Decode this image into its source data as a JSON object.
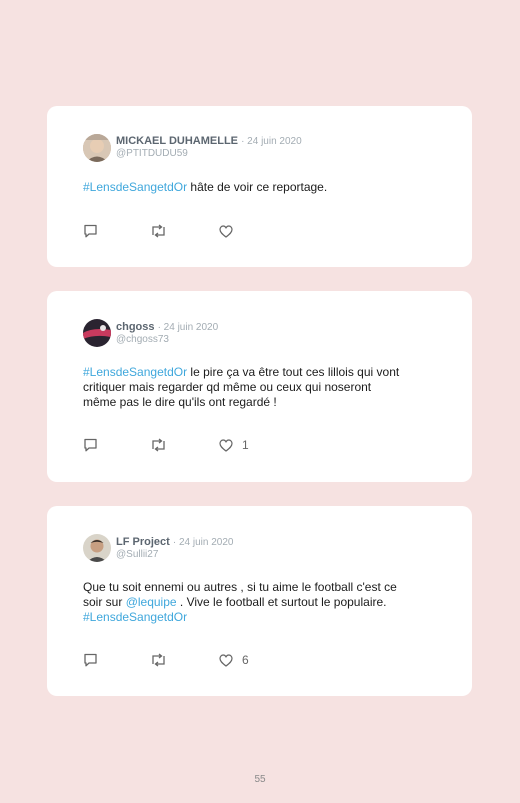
{
  "tweets": [
    {
      "name": "MICKAEL DUHAMELLE",
      "date": "· 24 juin 2020",
      "handle": "@PTITDUDU59",
      "lines": [
        [
          {
            "t": "#LensdeSangetdOr",
            "link": true
          },
          {
            "t": " hâte de voir ce reportage.",
            "link": false
          }
        ]
      ],
      "like_count": ""
    },
    {
      "name": "chgoss",
      "date": "· 24 juin 2020",
      "handle": "@chgoss73",
      "lines": [
        [
          {
            "t": "#LensdeSangetdOr",
            "link": true
          },
          {
            "t": " le pire ça va être tout ces lillois qui vont",
            "link": false
          }
        ],
        [
          {
            "t": "critiquer mais regarder qd même ou ceux qui noseront",
            "link": false
          }
        ],
        [
          {
            "t": "même pas le dire qu'ils ont regardé !",
            "link": false
          }
        ]
      ],
      "like_count": "1"
    },
    {
      "name": "LF Project",
      "date": "· 24 juin 2020",
      "handle": "@Sullii27",
      "lines": [
        [
          {
            "t": "Que tu soit ennemi ou autres , si tu aime le football c'est ce",
            "link": false
          }
        ],
        [
          {
            "t": "soir sur ",
            "link": false
          },
          {
            "t": "@lequipe",
            "link": true
          },
          {
            "t": " . Vive le football et surtout le populaire.",
            "link": false
          }
        ],
        [
          {
            "t": "#LensdeSangetdOr",
            "link": true
          }
        ]
      ],
      "like_count": "6"
    }
  ],
  "icons": {
    "reply": "comment-icon",
    "retweet": "retweet-icon",
    "like": "heart-icon"
  },
  "colors": {
    "background": "#f6e2e1",
    "card": "#ffffff",
    "link": "#3fa7dc",
    "name": "#5c6670",
    "meta": "#a3acb3"
  },
  "page_number": "55"
}
